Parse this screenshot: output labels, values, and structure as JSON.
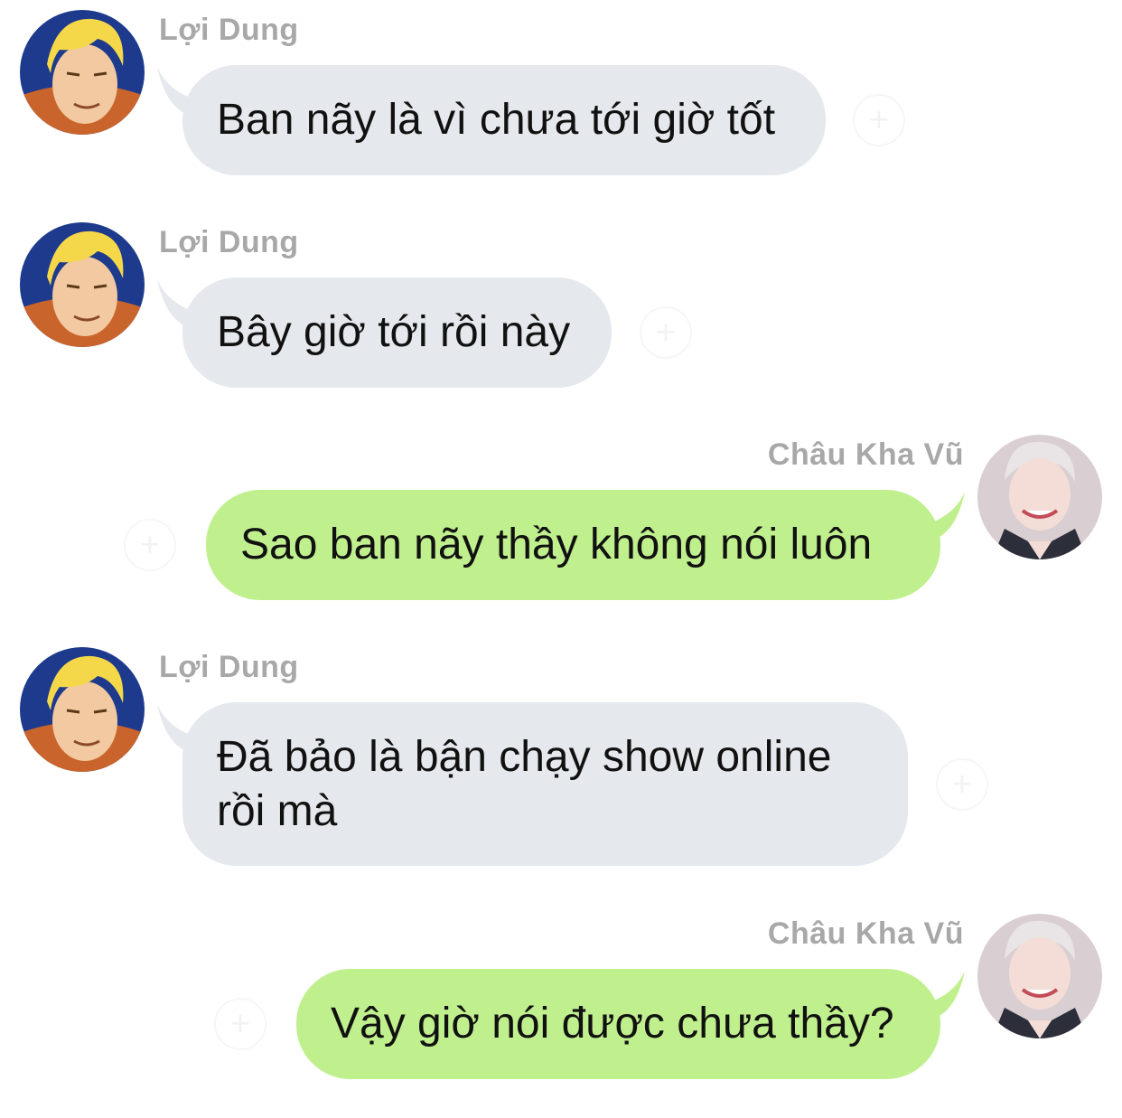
{
  "participants": {
    "other": {
      "name": "Lợi Dung",
      "avatar_icon": "cartoon-blond-man-avatar-icon"
    },
    "me": {
      "name": "Châu Kha Vũ",
      "avatar_icon": "photo-avatar-icon"
    }
  },
  "colors": {
    "incoming_bubble": "#e5e8ec",
    "outgoing_bubble": "#c0f08e",
    "sender_name": "#a8a8a8",
    "message_text": "#111111"
  },
  "messages": [
    {
      "sender": "Lợi Dung",
      "direction": "incoming",
      "text": "Ban nãy là vì chưa tới giờ tốt"
    },
    {
      "sender": "Lợi Dung",
      "direction": "incoming",
      "text": "Bây giờ tới rồi này"
    },
    {
      "sender": "Châu Kha Vũ",
      "direction": "outgoing",
      "text": "Sao ban nãy thầy không nói luôn"
    },
    {
      "sender": "Lợi Dung",
      "direction": "incoming",
      "text": "Đã bảo là bận chạy show online rồi mà"
    },
    {
      "sender": "Châu Kha Vũ",
      "direction": "outgoing",
      "text": "Vậy giờ nói được chưa thầy?"
    }
  ],
  "reaction_button_icon": "add-reaction-icon"
}
